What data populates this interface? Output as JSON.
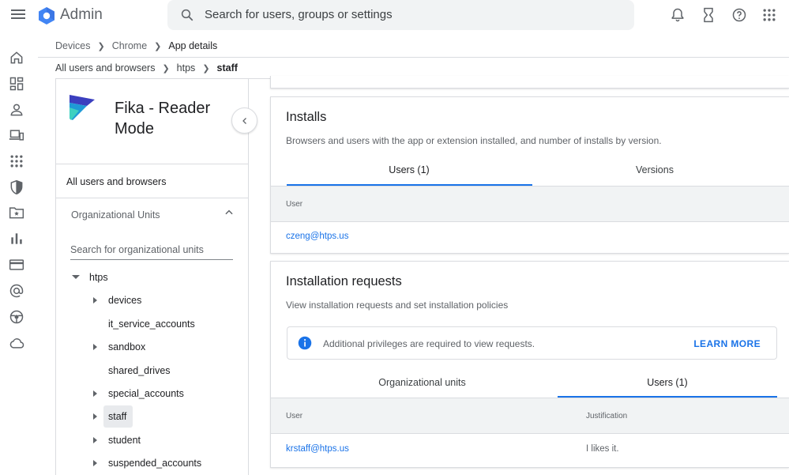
{
  "header": {
    "app_title": "Admin",
    "search_placeholder": "Search for users, groups or settings"
  },
  "rail": {
    "icons": [
      "home-icon",
      "dashboard-icon",
      "person-icon",
      "devices-icon",
      "apps-icon",
      "security-icon",
      "drive-folder-icon",
      "reporting-icon",
      "billing-icon",
      "account-at-icon",
      "rules-icon",
      "cloud-icon"
    ]
  },
  "breadcrumb": {
    "items": [
      "Devices",
      "Chrome",
      "App details"
    ]
  },
  "breadcrumb2": {
    "items": [
      "All users and browsers",
      "htps",
      "staff"
    ]
  },
  "app": {
    "name": "Fika - Reader Mode"
  },
  "left_panel": {
    "all_users": "All users and browsers",
    "ou_heading": "Organizational Units",
    "ou_search_placeholder": "Search for organizational units",
    "tree": [
      {
        "label": "htps",
        "expanded": true,
        "level": 0
      },
      {
        "label": "devices",
        "has_children": true,
        "level": 1
      },
      {
        "label": "it_service_accounts",
        "has_children": false,
        "level": 1
      },
      {
        "label": "sandbox",
        "has_children": true,
        "level": 1
      },
      {
        "label": "shared_drives",
        "has_children": false,
        "level": 1
      },
      {
        "label": "special_accounts",
        "has_children": true,
        "level": 1
      },
      {
        "label": "staff",
        "has_children": true,
        "level": 1,
        "selected": true
      },
      {
        "label": "student",
        "has_children": true,
        "level": 1
      },
      {
        "label": "suspended_accounts",
        "has_children": true,
        "level": 1
      }
    ]
  },
  "installs": {
    "title": "Installs",
    "description": "Browsers and users with the app or extension installed, and number of installs by version.",
    "tabs": [
      "Users (1)",
      "Versions"
    ],
    "active_tab": 0,
    "column": "User",
    "rows": [
      "czeng@htps.us"
    ]
  },
  "requests": {
    "title": "Installation requests",
    "description": "View installation requests and set installation policies",
    "notice": "Additional privileges are required to view requests.",
    "learn_more": "LEARN MORE",
    "tabs": [
      "Organizational units",
      "Users (1)"
    ],
    "active_tab": 1,
    "columns": [
      "User",
      "Justification"
    ],
    "rows": [
      {
        "user": "krstaff@htps.us",
        "justification": "I likes it."
      }
    ]
  },
  "colors": {
    "accent": "#1a73e8",
    "google_blue": "#4285f4"
  }
}
